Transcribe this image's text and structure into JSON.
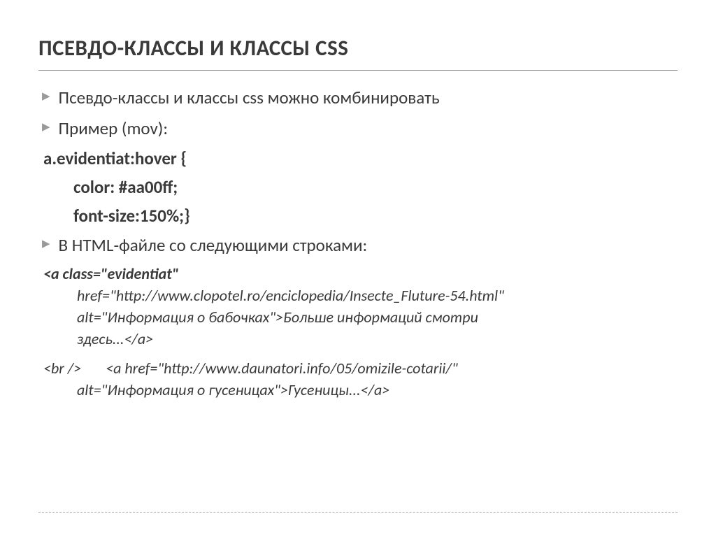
{
  "title": "ПСЕВДО-КЛАССЫ И КЛАССЫ CSS",
  "bullets": {
    "b1": "Псевдо-классы и классы css можно комбинировать",
    "b2": "Пример (mov):",
    "b3": "В HTML-файле со следующими строками:"
  },
  "code": {
    "l1": "a.evidentiat:hover {",
    "l2": "color: #aa00ff;",
    "l3": "font-size:150%;}"
  },
  "html": {
    "block1_open": "<a class=\"evidentiat\"",
    "block1_href": "href=\"http://www.clopotel.ro/enciclopedia/Insecte_Fluture-54.html\"",
    "block1_alt": "alt=\"Информация о бабочках\">Больше информаций смотри",
    "block1_end": "здесь...</a>",
    "block2_br": "<br />",
    "block2_a": "<a href=\"http://www.daunatori.info/05/omizile-cotarii/\"",
    "block2_alt": "alt=\"Информация о гусеницах\">Гусеницы...</a>"
  }
}
